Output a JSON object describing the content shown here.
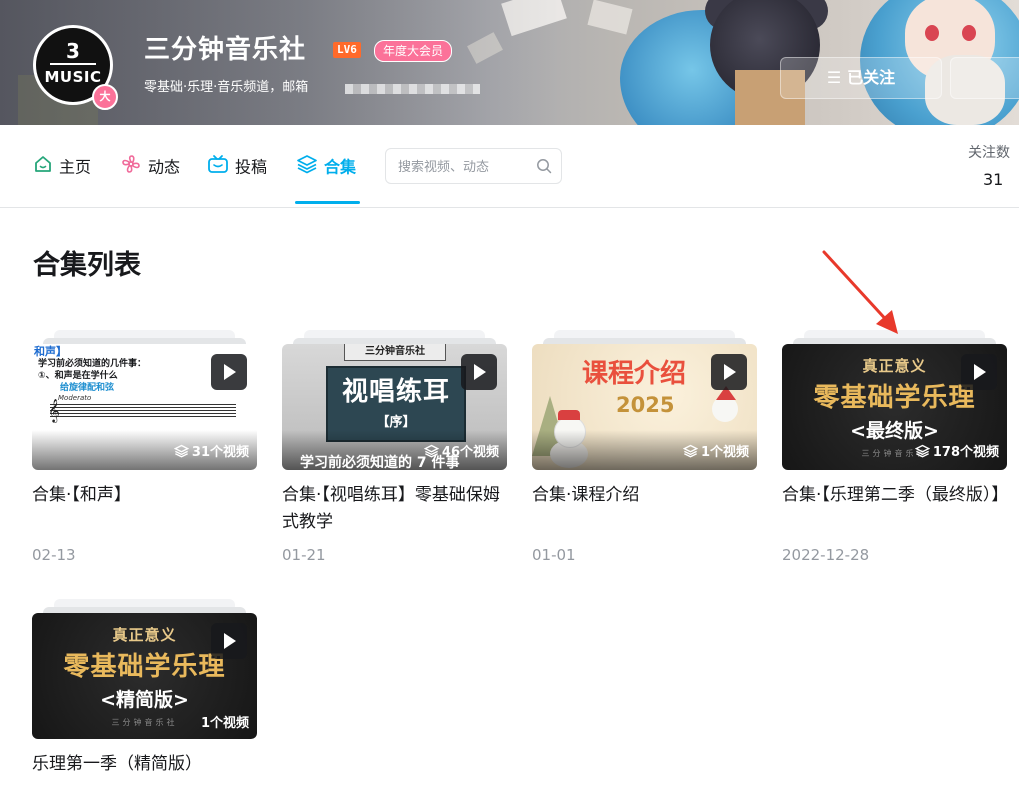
{
  "header": {
    "avatar_number": "3",
    "avatar_text": "MUSIC",
    "avatar_badge": "大",
    "name": "三分钟音乐社",
    "level": "LV6",
    "vip_badge": "年度大会员",
    "sign": "零基础·乐理·音乐频道，邮箱",
    "follow_button": "已关注"
  },
  "nav": {
    "tabs": [
      {
        "label": "主页",
        "icon": "home-icon"
      },
      {
        "label": "动态",
        "icon": "pinwheel-icon"
      },
      {
        "label": "投稿",
        "icon": "tv-icon"
      },
      {
        "label": "合集",
        "icon": "layers-icon",
        "active": true
      }
    ],
    "search_placeholder": "搜索视频、动态",
    "stat_label": "关注数",
    "stat_value": "31"
  },
  "section_title": "合集列表",
  "collections": [
    {
      "title": "合集·【和声】",
      "date": "02-13",
      "count": "31个视频",
      "thumb": {
        "header": "和声】",
        "line1": "学习前必须知道的几件事：",
        "line2": "①、和声是在学什么",
        "line3": "给旋律配和弦",
        "tempo": "Moderato"
      }
    },
    {
      "title": "合集·【视唱练耳】零基础保姆式教学",
      "date": "01-21",
      "count": "46个视频",
      "thumb": {
        "top": "三分钟音乐社",
        "main": "视唱练耳",
        "sub": "【序】",
        "bottom": "学习前必须知道的 7 件事"
      }
    },
    {
      "title": "合集·课程介绍",
      "date": "01-01",
      "count": "1个视频",
      "thumb": {
        "main": "课程介绍",
        "year": "2025"
      }
    },
    {
      "title": "合集·【乐理第二季（最终版）】",
      "date": "2022-12-28",
      "count": "178个视频",
      "thumb": {
        "line1": "真正意义",
        "line2": "零基础学乐理",
        "line3": "<最终版>",
        "footer": "三分钟音乐社"
      }
    },
    {
      "title": "乐理第一季（精简版）",
      "date": "",
      "count": "1个视频",
      "thumb": {
        "line1": "真正意义",
        "line2": "零基础学乐理",
        "line3": "<精简版>",
        "footer": "三分钟音乐社"
      }
    }
  ],
  "colors": {
    "accent": "#00aeec",
    "pink": "#fb7299",
    "level": "#ff6a2a",
    "arrow": "#e8392b"
  }
}
